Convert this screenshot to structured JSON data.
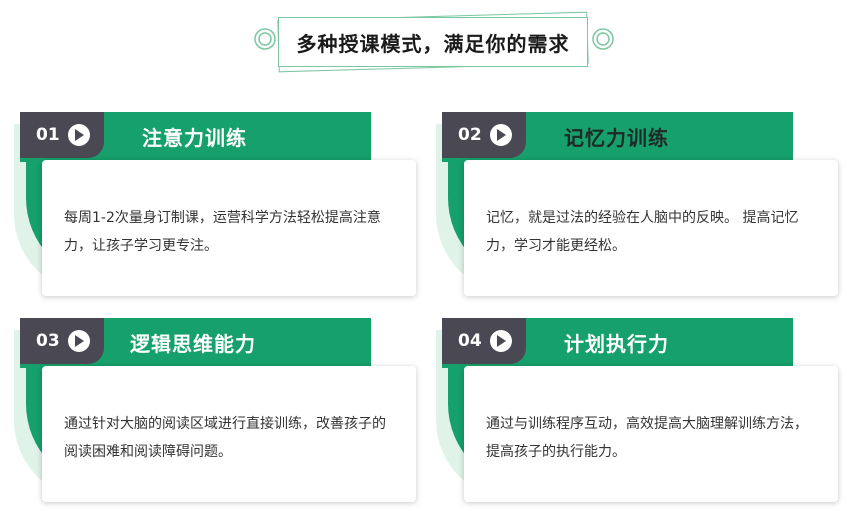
{
  "header": {
    "title": "多种授课模式，满足你的需求"
  },
  "colors": {
    "accent_green": "#16a06b",
    "light_green": "#dff3e8",
    "number_box": "#4a4953",
    "frame_line": "#7cc6a2"
  },
  "cards": [
    {
      "number": "01",
      "title": "注意力训练",
      "description": "每周1-2次量身订制课，运营科学方法轻松提高注意力，让孩子学习更专注。",
      "icon": "play-circle-icon"
    },
    {
      "number": "02",
      "title": "记忆力训练",
      "description": "记忆，就是过法的经验在人脑中的反映。 提高记忆力，学习才能更经松。",
      "icon": "play-circle-icon"
    },
    {
      "number": "03",
      "title": "逻辑思维能力",
      "description": "通过针对大脑的阅读区域进行直接训练，改善孩子的阅读困难和阅读障碍问题。",
      "icon": "play-circle-icon"
    },
    {
      "number": "04",
      "title": "计划执行力",
      "description": "通过与训练程序互动，高效提高大脑理解训练方法，提高孩子的执行能力。",
      "icon": "play-circle-icon"
    }
  ]
}
